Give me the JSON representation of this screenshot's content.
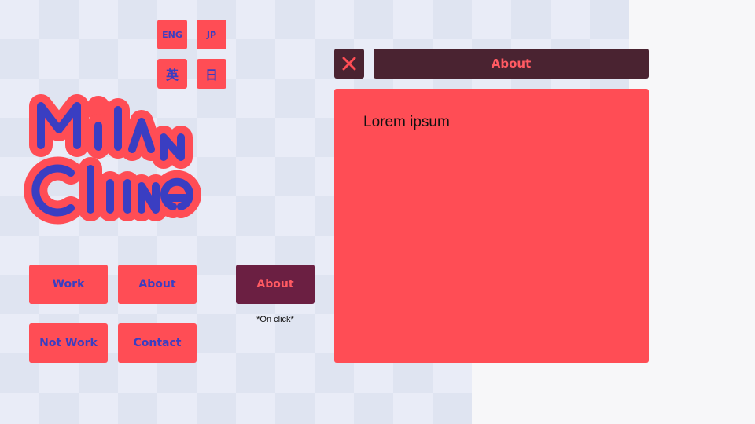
{
  "languages": [
    {
      "label": "ENG"
    },
    {
      "label": "JP"
    },
    {
      "label": "英"
    },
    {
      "label": "日"
    }
  ],
  "logo": {
    "text": "Milan Cline"
  },
  "nav": {
    "work": "Work",
    "about": "About",
    "not_work": "Not Work",
    "contact": "Contact",
    "about_active": "About",
    "click_note": "*On click*"
  },
  "window": {
    "title": "About",
    "body_text": "Lorem ipsum"
  },
  "colors": {
    "accent": "#ff4d55",
    "ink": "#3a3ec2",
    "dark": "#4a2331",
    "active": "#6b1f42"
  },
  "icons": {
    "close": "close-icon"
  }
}
